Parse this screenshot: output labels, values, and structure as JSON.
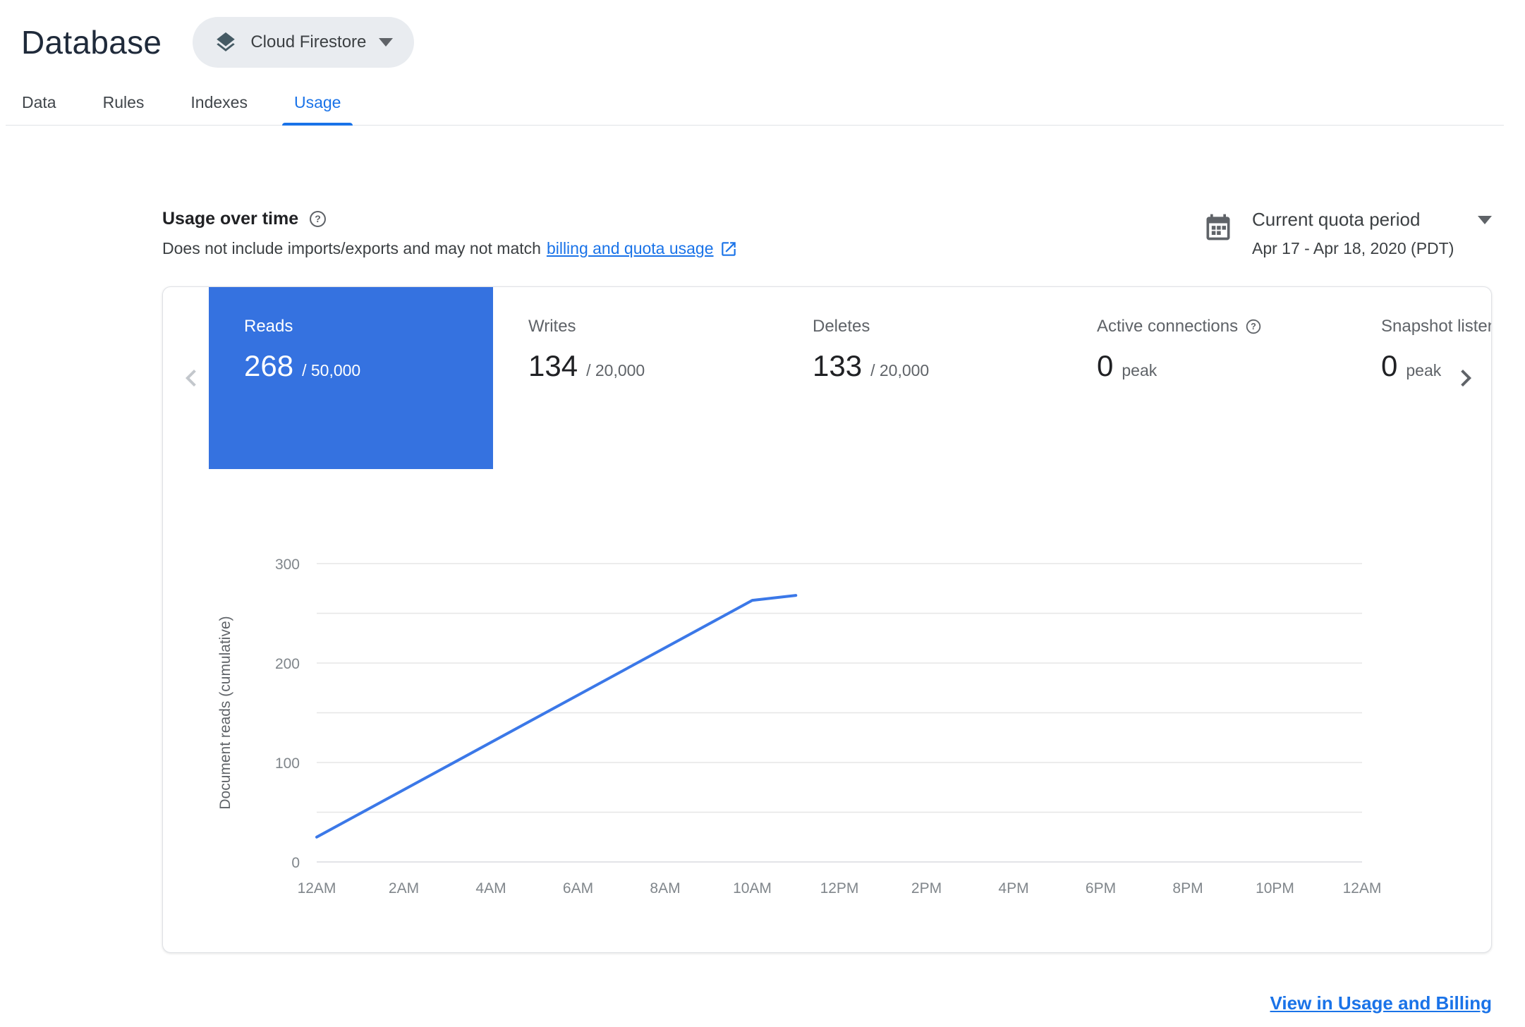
{
  "header": {
    "title": "Database",
    "product_selector": {
      "label": "Cloud Firestore"
    }
  },
  "tabs": [
    {
      "label": "Data",
      "active": false
    },
    {
      "label": "Rules",
      "active": false
    },
    {
      "label": "Indexes",
      "active": false
    },
    {
      "label": "Usage",
      "active": true
    }
  ],
  "usage_section": {
    "title": "Usage over time",
    "subtitle_prefix": "Does not include imports/exports and may not match",
    "subtitle_link": "billing and quota usage",
    "quota_period": {
      "label": "Current quota period",
      "range": "Apr 17 - Apr 18, 2020 (PDT)"
    }
  },
  "metrics": [
    {
      "label": "Reads",
      "value": "268",
      "suffix": "/ 50,000",
      "selected": true
    },
    {
      "label": "Writes",
      "value": "134",
      "suffix": "/ 20,000",
      "selected": false
    },
    {
      "label": "Deletes",
      "value": "133",
      "suffix": "/ 20,000",
      "selected": false
    },
    {
      "label": "Active connections",
      "value": "0",
      "suffix": "peak",
      "selected": false,
      "has_help": true
    },
    {
      "label": "Snapshot listeners",
      "value": "0",
      "suffix": "peak",
      "selected": false
    }
  ],
  "chart_data": {
    "type": "line",
    "title": "",
    "xlabel": "",
    "ylabel": "Document reads (cumulative)",
    "x_ticks": [
      "12AM",
      "2AM",
      "4AM",
      "6AM",
      "8AM",
      "10AM",
      "12PM",
      "2PM",
      "4PM",
      "6PM",
      "8PM",
      "10PM",
      "12AM"
    ],
    "x_range_hours": [
      0,
      24
    ],
    "y_ticks": [
      0,
      100,
      200,
      300
    ],
    "ylim": [
      0,
      300
    ],
    "gridline_step": 50,
    "grid": true,
    "legend": "none",
    "line_color": "#3b78e8",
    "series": [
      {
        "name": "Document reads (cumulative)",
        "points": [
          {
            "hour": 0,
            "value": 25
          },
          {
            "hour": 10,
            "value": 263
          },
          {
            "hour": 11,
            "value": 268
          }
        ]
      }
    ]
  },
  "footer": {
    "link_label": "View in Usage and Billing"
  },
  "colors": {
    "accent_blue": "#1a73e8",
    "selected_tile_blue": "#3572e0",
    "chart_line_blue": "#3b78e8"
  },
  "icons": {
    "firestore-icon": "stacked-layers",
    "chevron-down-icon": "▾",
    "help-icon": "?",
    "external-link-icon": "open-in-new",
    "calendar-icon": "calendar",
    "chevron-left-icon": "‹",
    "chevron-right-icon": "›"
  }
}
